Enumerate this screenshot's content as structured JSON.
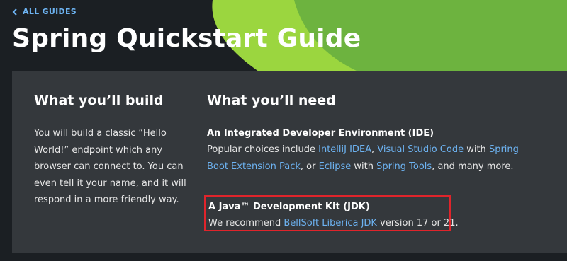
{
  "nav": {
    "back_label": "ALL GUIDES"
  },
  "page": {
    "title": "Spring Quickstart Guide"
  },
  "build": {
    "heading": "What you’ll build",
    "text": "You will build a classic “Hello World!” endpoint which any browser can connect to. You can even tell it your name, and it will respond in a more friendly way."
  },
  "need": {
    "heading": "What you’ll need",
    "ide": {
      "title": "An Integrated Developer Environment (IDE)",
      "prefix": "Popular choices include ",
      "link_intellij": "IntelliJ IDEA",
      "sep1": ", ",
      "link_vscode": "Visual Studio Code",
      "with1": " with ",
      "link_sbep": "Spring Boot Extension Pack",
      "or": ", or ",
      "link_eclipse": "Eclipse",
      "with2": " with ",
      "link_springtools": "Spring Tools",
      "suffix": ", and many more."
    },
    "jdk": {
      "title": "A Java™ Development Kit (JDK)",
      "prefix": "We recommend ",
      "link_liberica": "BellSoft Liberica JDK",
      "suffix": " version 17 or 21."
    }
  },
  "colors": {
    "background": "#1b1f23",
    "card": "#34383c",
    "link": "#6db3f2",
    "highlight_border": "#e0242b",
    "hero_green": "#6db33f",
    "hero_light_green": "#9bd63f"
  },
  "icons": {
    "back": "chevron-left-icon"
  }
}
